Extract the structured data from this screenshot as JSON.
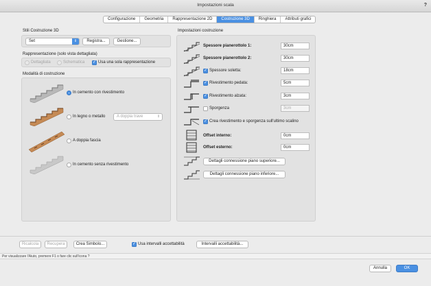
{
  "window": {
    "title": "Impostazioni scala",
    "help": "?"
  },
  "tabs": [
    "Configurazione",
    "Geometria",
    "Rappresentazione 2D",
    "Costruzione 3D",
    "Ringhiera",
    "Attributi grafici"
  ],
  "left": {
    "stili_title": "Stili Costruzione 3D",
    "set_value": "Set",
    "registra_label": "Registra...",
    "gestione_label": "Gestione...",
    "rappr_title": "Rappresentazione (solo vista dettagliata)",
    "dettagliata": "Dettagliata",
    "schematica": "Schematica",
    "usa_una_sola": "Usa una sola rappresentazione",
    "modalita_title": "Modalità di costruzione",
    "options": {
      "cemento_riv": "In cemento con rivestimento",
      "legno_metallo": "In legno o metallo",
      "doppia_trave": "A doppia trave",
      "doppia_fascia": "A doppia fascia",
      "cemento_senza": "In cemento senza rivestimento"
    }
  },
  "right": {
    "title": "Impostazioni costruzione",
    "rows": {
      "sp_pian1": {
        "label": "Spessore pianerottolo 1:",
        "value": "30cm"
      },
      "sp_pian2": {
        "label": "Spessore pianerottolo 2:",
        "value": "30cm"
      },
      "sp_soletta": {
        "label": "Spessore soletta:",
        "value": "18cm"
      },
      "riv_pedata": {
        "label": "Rivestimento pedata:",
        "value": "5cm"
      },
      "riv_alzata": {
        "label": "Rivestimento alzata:",
        "value": "3cm"
      },
      "sporgenza": {
        "label": "Sporgenza",
        "value": "3cm"
      },
      "crea_riv": {
        "label": "Crea rivestimento e sporgenza sull'ultimo scalino"
      },
      "offset_int": {
        "label": "Offset interno:",
        "value": "0cm"
      },
      "offset_est": {
        "label": "Offset esterno:",
        "value": "0cm"
      }
    },
    "dettagli_sup": "Dettagli connessione piano superiore...",
    "dettagli_inf": "Dettagli connessione piano inferiore..."
  },
  "bottom": {
    "ricalcola": "Ricalcola",
    "recupera": "Recupera",
    "crea_simbolo": "Crea Simbolo...",
    "usa_intervalli": "Usa intervalli accettabilità",
    "intervalli": "Intervalli accettabilità...",
    "status": "Per visualizzare l'Aiuto, premere F1 o fare clic sull'icona ?",
    "annulla": "Annulla",
    "ok": "OK"
  },
  "colors": {
    "accent": "#4a90e2",
    "panel": "#e2e2e2",
    "window": "#ececec"
  }
}
